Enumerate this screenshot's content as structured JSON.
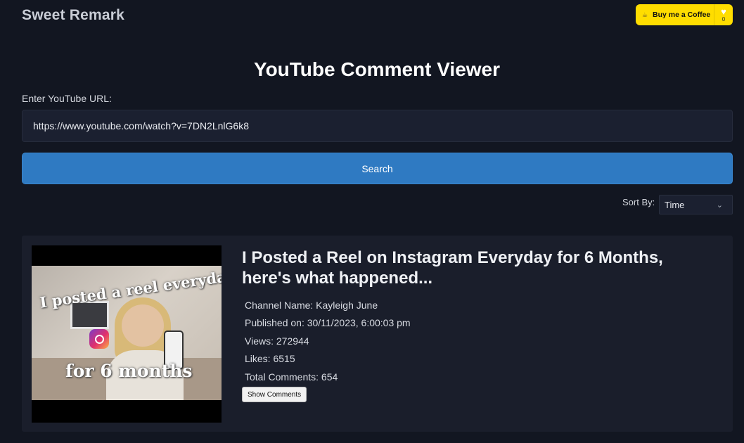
{
  "header": {
    "brand": "Sweet Remark",
    "coffee_label": "Buy me a Coffee",
    "coffee_count": "0"
  },
  "main": {
    "title": "YouTube Comment Viewer",
    "url_label": "Enter YouTube URL:",
    "url_value": "https://www.youtube.com/watch?v=7DN2LnlG6k8",
    "search_label": "Search",
    "sort_label": "Sort By:",
    "sort_value": "Time"
  },
  "video": {
    "title": "I Posted a Reel on Instagram Everyday for 6 Months, here's what happened...",
    "thumbnail_text_1": "I posted a reel everyday",
    "thumbnail_text_2": "for 6 months",
    "channel": "Channel Name: Kayleigh June",
    "published": "Published on: 30/11/2023, 6:00:03 pm",
    "views": "Views: 272944",
    "likes": "Likes: 6515",
    "comments": "Total Comments: 654",
    "show_comments_label": "Show Comments"
  },
  "colors": {
    "background": "#121621",
    "accent": "#2f7ac2",
    "coffee_yellow": "#ffdd00"
  }
}
